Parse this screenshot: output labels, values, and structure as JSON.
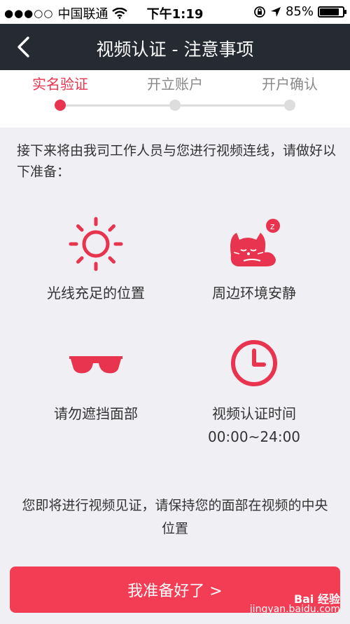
{
  "status_bar": {
    "signal_dots": "●●●○○",
    "carrier": "中国联通",
    "time": "下午1:19",
    "battery_text": "85%",
    "battery_level": 0.85
  },
  "nav": {
    "title": "视频认证 - 注意事项"
  },
  "steps": [
    {
      "label": "实名验证",
      "active": true
    },
    {
      "label": "开立账户",
      "active": false
    },
    {
      "label": "开户确认",
      "active": false
    }
  ],
  "intro_text": "接下来将由我司工作人员与您进行视频连线，请做好以下准备：",
  "requirements": [
    {
      "icon": "sun-icon",
      "label": "光线充足的位置"
    },
    {
      "icon": "sleeping-cat-icon",
      "label": "周边环境安静"
    },
    {
      "icon": "sunglasses-icon",
      "label": "请勿遮挡面部"
    },
    {
      "icon": "clock-icon",
      "label": "视频认证时间",
      "sub": "00:00~24:00"
    }
  ],
  "notice_text": "您即将进行视频见证，请保持您的面部在视频的中央位置",
  "ready_button": "我准备好了 >",
  "watermark": {
    "brand": "Bai 经验",
    "site": "jingyan.baidu.com"
  },
  "colors": {
    "accent": "#e8344e",
    "nav_bg": "#262a33",
    "button": "#f23d55"
  }
}
